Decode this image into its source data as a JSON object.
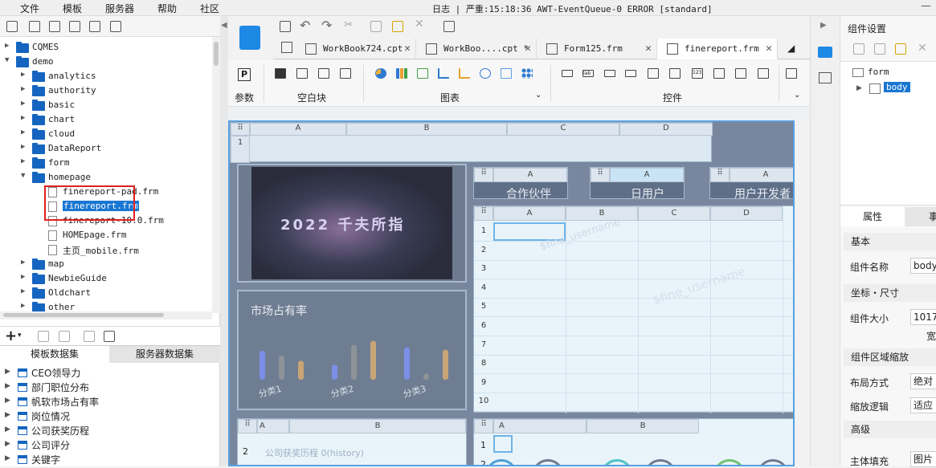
{
  "menu": {
    "file": "文件",
    "template": "模板",
    "server": "服务器",
    "help": "帮助",
    "community": "社区"
  },
  "log": {
    "text": "日志 | 严重:15:18:36 AWT-EventQueue-0 ERROR [standard]"
  },
  "tree": {
    "items": [
      {
        "label": "CQMES",
        "type": "folder",
        "expanded": false
      },
      {
        "label": "demo",
        "type": "folder",
        "expanded": true
      },
      {
        "label": "analytics",
        "type": "folder"
      },
      {
        "label": "authority",
        "type": "folder"
      },
      {
        "label": "basic",
        "type": "folder"
      },
      {
        "label": "chart",
        "type": "folder"
      },
      {
        "label": "cloud",
        "type": "folder"
      },
      {
        "label": "DataReport",
        "type": "folder"
      },
      {
        "label": "form",
        "type": "folder"
      },
      {
        "label": "homepage",
        "type": "folder",
        "expanded": true
      },
      {
        "label": "finereport-pad.frm",
        "type": "file"
      },
      {
        "label": "finereport.frm",
        "type": "file",
        "selected": true
      },
      {
        "label": "finereport-10.0.frm",
        "type": "file"
      },
      {
        "label": "HOMEpage.frm",
        "type": "file"
      },
      {
        "label": "主页_mobile.frm",
        "type": "file"
      },
      {
        "label": "map",
        "type": "folder"
      },
      {
        "label": "NewbieGuide",
        "type": "folder"
      },
      {
        "label": "Oldchart",
        "type": "folder"
      },
      {
        "label": "other",
        "type": "folder"
      }
    ]
  },
  "dataset_tabs": {
    "template": "模板数据集",
    "server": "服务器数据集"
  },
  "datasets": [
    "CEO领导力",
    "部门职位分布",
    "帆软市场占有率",
    "岗位情况",
    "公司获奖历程",
    "公司评分",
    "关键字"
  ],
  "tabs": [
    {
      "label": "WorkBook724.cpt",
      "active": false
    },
    {
      "label": "WorkBoo....cpt *",
      "active": false
    },
    {
      "label": "Form125.frm",
      "active": false
    },
    {
      "label": "finereport.frm",
      "active": true
    }
  ],
  "ribbon": {
    "param": "参数",
    "blank": "空白块",
    "chart": "图表",
    "control": "控件"
  },
  "canvas": {
    "top_cols": [
      "A",
      "B",
      "C",
      "D"
    ],
    "market_title": "市场占有率",
    "categories": [
      "分类1",
      "分类2",
      "分类3"
    ],
    "bar_series": [
      {
        "color": "#7b8fe8",
        "values": [
          0.58,
          0.3,
          0.65
        ]
      },
      {
        "color": "#8d9396",
        "values": [
          0.48,
          0.7,
          0.12
        ]
      },
      {
        "color": "#c8a576",
        "values": [
          0.38,
          0.78,
          0.6
        ]
      }
    ],
    "sheet_cols": [
      "A",
      "B",
      "C",
      "D"
    ],
    "sheet_rows": [
      "1",
      "2",
      "3",
      "4",
      "5",
      "6",
      "7",
      "8",
      "9",
      "10"
    ],
    "small_headers": [
      {
        "col": "A",
        "text": "合作伙伴"
      },
      {
        "col": "A",
        "text": "日用户"
      },
      {
        "col": "A",
        "text": "用户开发者"
      }
    ],
    "bottom_text": "公司获奖历程  0(history)",
    "bottom_cols": [
      "A",
      "B"
    ],
    "bottom_rows": [
      "2"
    ],
    "bottom_right_cols": [
      "A",
      "B"
    ],
    "bottom_right_rows": [
      "1",
      "2"
    ],
    "watermark": "$fine_username",
    "hero_text": "2022 千夫所指"
  },
  "right": {
    "title": "组件设置",
    "tree_root": "form",
    "tree_child": "body",
    "tab_attr": "属性",
    "tab_event": "事",
    "sec_basic": "基本",
    "name_label": "组件名称",
    "name_value": "body",
    "sec_pos": "坐标・尺寸",
    "size_label": "组件大小",
    "size_value": "1017",
    "width_label": "宽",
    "sec_scale": "组件区域缩放",
    "layout_label": "布局方式",
    "layout_value": "绝对",
    "zoom_label": "缩放逻辑",
    "zoom_value": "适应",
    "sec_adv": "高级",
    "fill_label": "主体填充",
    "fill_value": "图片"
  }
}
